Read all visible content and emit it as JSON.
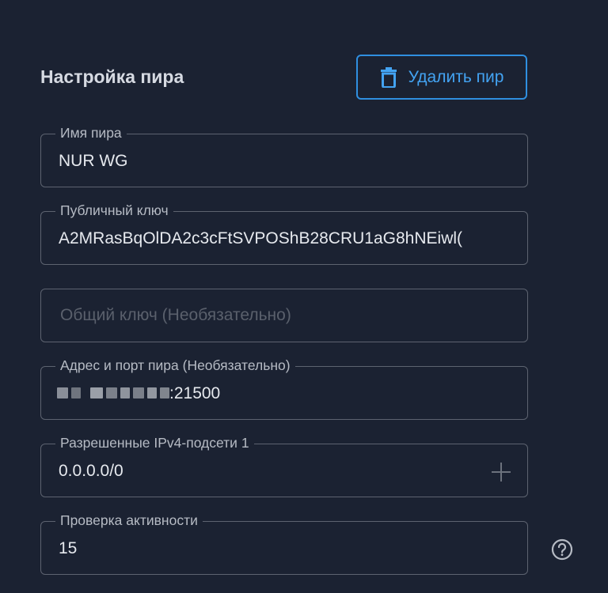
{
  "header": {
    "title": "Настройка пира",
    "delete_button_label": "Удалить пир"
  },
  "fields": {
    "peer_name": {
      "label": "Имя пира",
      "value": "NUR WG"
    },
    "public_key": {
      "label": "Публичный ключ",
      "value": "A2MRasBqOlDA2c3cFtSVPOShB28CRU1aG8hNEiwl("
    },
    "preshared_key": {
      "placeholder": "Общий ключ (Необязательно)"
    },
    "endpoint": {
      "label": "Адрес и порт пира (Необязательно)",
      "value_suffix": ":21500"
    },
    "allowed_ips": {
      "label": "Разрешенные IPv4-подсети 1",
      "value": "0.0.0.0/0"
    },
    "keepalive": {
      "label": "Проверка активности",
      "value": "15"
    }
  },
  "colors": {
    "background": "#1b2232",
    "accent": "#2f8fe0",
    "border": "#5d6370",
    "text": "#e6e9ee",
    "label": "#b6bbc4"
  },
  "icons": {
    "delete": "trash-icon",
    "add": "plus-icon",
    "help": "help-icon"
  }
}
